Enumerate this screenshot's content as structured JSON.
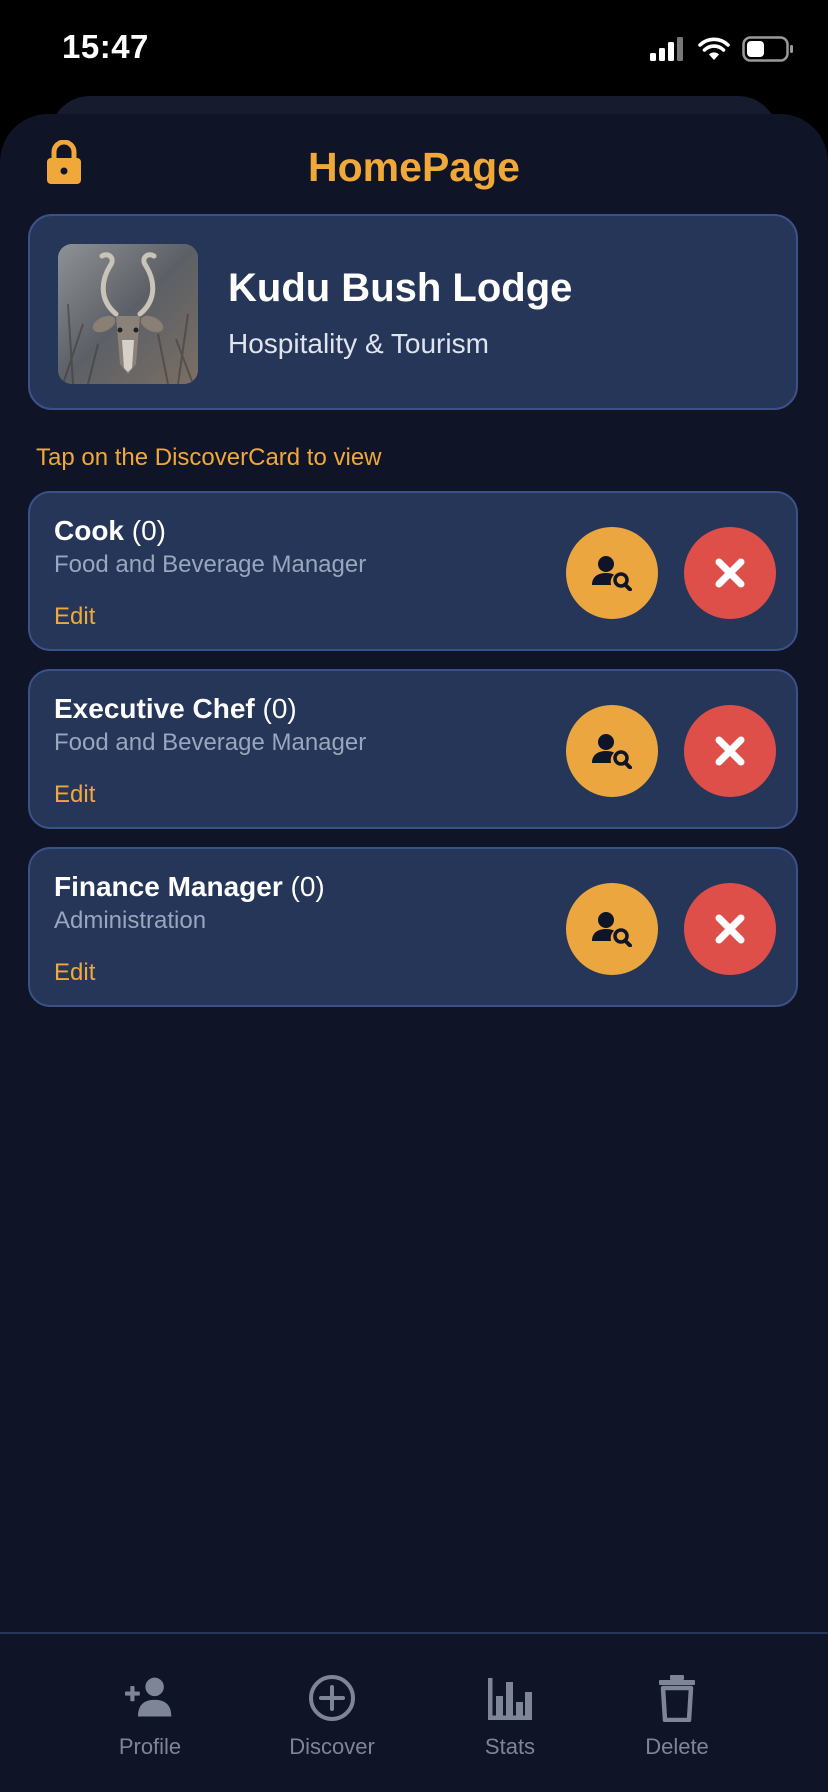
{
  "status_bar": {
    "time": "15:47"
  },
  "header": {
    "title": "HomePage",
    "lock_icon": "lock-icon"
  },
  "profile": {
    "name": "Kudu Bush Lodge",
    "sector": "Hospitality & Tourism"
  },
  "hint": "Tap on the DiscoverCard to view",
  "jobs": [
    {
      "title": "Cook",
      "count": "(0)",
      "department": "Food and Beverage Manager",
      "edit_label": "Edit"
    },
    {
      "title": "Executive Chef",
      "count": "(0)",
      "department": "Food and Beverage Manager",
      "edit_label": "Edit"
    },
    {
      "title": "Finance Manager",
      "count": "(0)",
      "department": "Administration",
      "edit_label": "Edit"
    }
  ],
  "bottom_nav": {
    "items": [
      {
        "label": "Profile",
        "icon": "add-person-icon"
      },
      {
        "label": "Discover",
        "icon": "add-circle-icon"
      },
      {
        "label": "Stats",
        "icon": "bar-chart-icon"
      },
      {
        "label": "Delete",
        "icon": "trash-icon"
      }
    ]
  },
  "colors": {
    "accent": "#f0a83a",
    "card": "#253658",
    "background": "#0f1426",
    "danger": "#df4f4a"
  }
}
